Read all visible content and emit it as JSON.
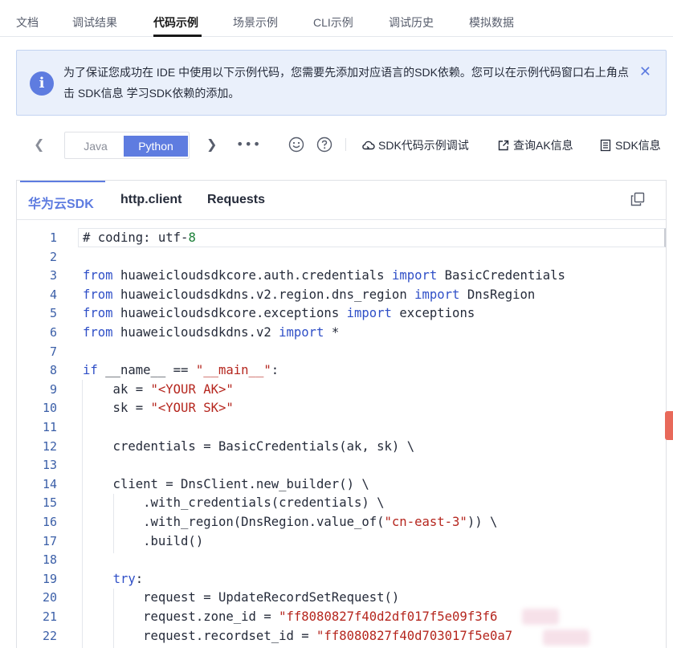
{
  "top_tabs": [
    {
      "label": "文档",
      "active": false
    },
    {
      "label": "调试结果",
      "active": false
    },
    {
      "label": "代码示例",
      "active": true
    },
    {
      "label": "场景示例",
      "active": false
    },
    {
      "label": "CLI示例",
      "active": false
    },
    {
      "label": "调试历史",
      "active": false
    },
    {
      "label": "模拟数据",
      "active": false
    }
  ],
  "notice": {
    "icon": "info-icon",
    "text": "为了保证您成功在 IDE 中使用以下示例代码，您需要先添加对应语言的SDK依赖。您可以在示例代码窗口右上角点击 SDK信息 学习SDK依赖的添加。",
    "close_icon": "close-icon"
  },
  "toolbar": {
    "languages": [
      {
        "label": "Java",
        "selected": false
      },
      {
        "label": "Python",
        "selected": true
      }
    ],
    "more_label": "•••",
    "icons": [
      "smile-icon",
      "help-icon"
    ],
    "actions": [
      {
        "label": "SDK代码示例调试",
        "icon": "cloud-debug-icon"
      },
      {
        "label": "查询AK信息",
        "icon": "external-link-icon"
      },
      {
        "label": "SDK信息",
        "icon": "document-icon"
      }
    ]
  },
  "code_tabs": [
    {
      "label": "华为云SDK",
      "active": true
    },
    {
      "label": "http.client",
      "active": false
    },
    {
      "label": "Requests",
      "active": false
    }
  ],
  "code": {
    "language": "python",
    "lines": [
      {
        "no": "1",
        "text": "# coding: utf-8"
      },
      {
        "no": "2",
        "text": ""
      },
      {
        "no": "3",
        "text": "from huaweicloudsdkcore.auth.credentials import BasicCredentials"
      },
      {
        "no": "4",
        "text": "from huaweicloudsdkdns.v2.region.dns_region import DnsRegion"
      },
      {
        "no": "5",
        "text": "from huaweicloudsdkcore.exceptions import exceptions"
      },
      {
        "no": "6",
        "text": "from huaweicloudsdkdns.v2 import *"
      },
      {
        "no": "7",
        "text": ""
      },
      {
        "no": "8",
        "text": "if __name__ == \"__main__\":"
      },
      {
        "no": "9",
        "text": "    ak = \"<YOUR AK>\""
      },
      {
        "no": "10",
        "text": "    sk = \"<YOUR SK>\""
      },
      {
        "no": "11",
        "text": ""
      },
      {
        "no": "12",
        "text": "    credentials = BasicCredentials(ak, sk) \\"
      },
      {
        "no": "13",
        "text": ""
      },
      {
        "no": "14",
        "text": "    client = DnsClient.new_builder() \\"
      },
      {
        "no": "15",
        "text": "        .with_credentials(credentials) \\"
      },
      {
        "no": "16",
        "text": "        .with_region(DnsRegion.value_of(\"cn-east-3\")) \\"
      },
      {
        "no": "17",
        "text": "        .build()"
      },
      {
        "no": "18",
        "text": ""
      },
      {
        "no": "19",
        "text": "    try:"
      },
      {
        "no": "20",
        "text": "        request = UpdateRecordSetRequest()"
      },
      {
        "no": "21",
        "text": "        request.zone_id = \"ff8080827f40d2df017f5e09f3f6"
      },
      {
        "no": "22",
        "text": "        request.recordset_id = \"ff8080827f40d703017f5e0a7"
      }
    ]
  }
}
